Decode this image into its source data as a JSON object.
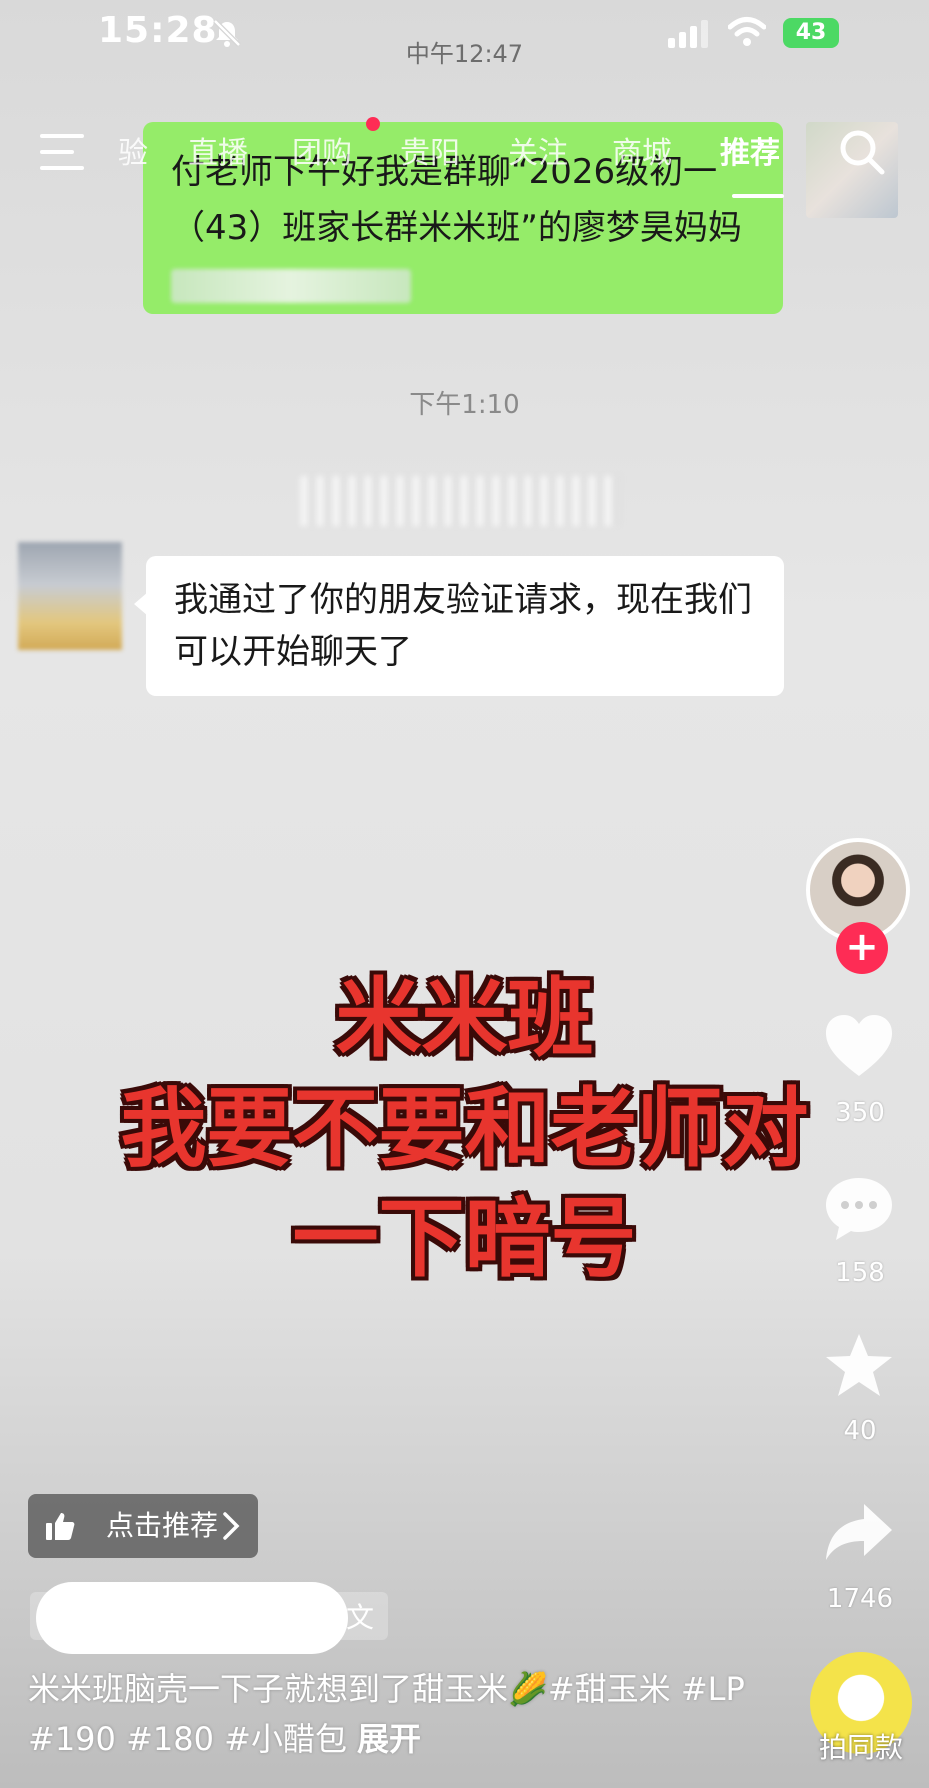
{
  "status_bar": {
    "time": "15:28",
    "battery": "43"
  },
  "inner_screenshot": {
    "time_top": "中午12:47",
    "time_mid": "下午1:10",
    "green_message": "付老师下午好我是群聊“2026级初一（43）班家长群米米班”的廖梦昊妈妈",
    "white_message": "我通过了你的朋友验证请求，现在我们可以开始聊天了"
  },
  "nav": {
    "tabs": [
      "验",
      "直播",
      "团购",
      "贵阳",
      "关注",
      "商城",
      "推荐"
    ],
    "active_tab": "推荐"
  },
  "overlay": {
    "line1": "米米班",
    "line2": "我要不要和老师对",
    "line3": "一下暗号"
  },
  "actions": {
    "likes": "350",
    "comments": "158",
    "favorites": "40",
    "shares": "1746",
    "same_style": "拍同款"
  },
  "bottom": {
    "recommend_label": "点击推荐",
    "author_suffix": "文",
    "caption": "米米班脑壳一下子就想到了甜玉米🌽#甜玉米 #LP #190 #180 #小醋包",
    "expand": "展开"
  },
  "colors": {
    "accent": "#fe2c55",
    "wechat_green": "#95ec69",
    "overlay_red": "#e8352e"
  },
  "icons": [
    "bell-slash-icon",
    "signal-icon",
    "wifi-icon",
    "menu-icon",
    "search-icon",
    "plus-icon",
    "heart-icon",
    "comment-icon",
    "star-icon",
    "share-icon",
    "thumb-up-icon",
    "chevron-right-icon"
  ]
}
